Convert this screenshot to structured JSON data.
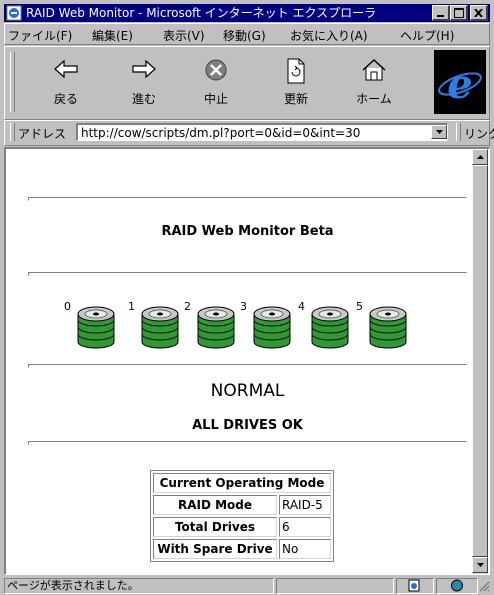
{
  "window": {
    "title": "RAID Web Monitor - Microsoft インターネット エクスプローラ",
    "controls": {
      "minimize": "_",
      "maximize": "□",
      "close": "×"
    }
  },
  "menu": {
    "items": [
      "ファイル(F)",
      "編集(E)",
      "表示(V)",
      "移動(G)",
      "お気に入り(A)",
      "ヘルプ(H)"
    ]
  },
  "toolbar": {
    "back": "戻る",
    "forward": "進む",
    "stop": "中止",
    "refresh": "更新",
    "home": "ホーム"
  },
  "address": {
    "label": "アドレス",
    "url": "http://cow/scripts/dm.pl?port=0&id=0&int=30",
    "links_label": "リンク"
  },
  "page": {
    "title": "RAID Web Monitor Beta",
    "drives": [
      "0",
      "1",
      "2",
      "3",
      "4",
      "5"
    ],
    "status": "NORMAL",
    "status_detail": "ALL DRIVES OK",
    "mode_table": {
      "header": "Current Operating Mode",
      "rows": [
        {
          "label": "RAID Mode",
          "value": "RAID-5"
        },
        {
          "label": "Total Drives",
          "value": "6"
        },
        {
          "label": "With Spare Drive",
          "value": "No"
        }
      ]
    }
  },
  "statusbar": {
    "text": "ページが表示されました。"
  },
  "colors": {
    "titlebar": "#000080",
    "drive_green": "#2f9a35",
    "drive_disk": "#c8c8c8"
  }
}
